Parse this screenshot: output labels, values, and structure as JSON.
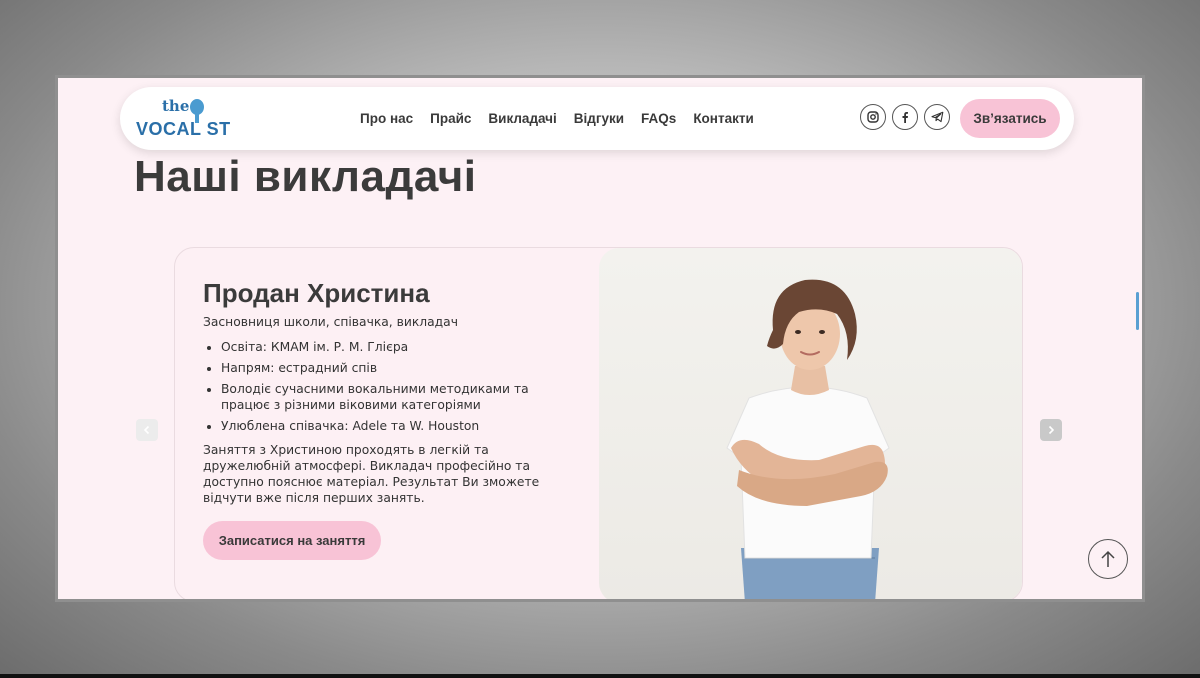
{
  "brand": {
    "logo_line1": "the",
    "logo_line2": "VOCAL ST"
  },
  "nav": {
    "items": [
      {
        "label": "Про нас"
      },
      {
        "label": "Прайс"
      },
      {
        "label": "Викладачі"
      },
      {
        "label": "Відгуки"
      },
      {
        "label": "FAQs"
      },
      {
        "label": "Контакти"
      }
    ],
    "socials": [
      "instagram-icon",
      "facebook-icon",
      "telegram-icon"
    ],
    "contact_label": "Зв’язатись"
  },
  "section": {
    "title": "Наші викладачі"
  },
  "teacher": {
    "name": "Продан Христина",
    "role": "Засновниця школи, співачка, викладач",
    "facts": [
      "Освіта: КМАМ ім. Р. М. Глієра",
      "Напрям: естрадний спів",
      "Володіє сучасними вокальними методиками та працює з різними віковими категоріями",
      "Улюблена співачка: Adele та W. Houston"
    ],
    "description": "Заняття з Христиною проходять в легкій та дружелюбній атмосфері. Викладач професійно та доступно пояснює матеріал. Результат Ви зможете відчути вже після перших занять.",
    "signup_label": "Записатися на заняття"
  },
  "colors": {
    "accent_pink": "#f8c3d6",
    "page_bg": "#fdf1f5",
    "logo_blue": "#2a6fa8"
  }
}
